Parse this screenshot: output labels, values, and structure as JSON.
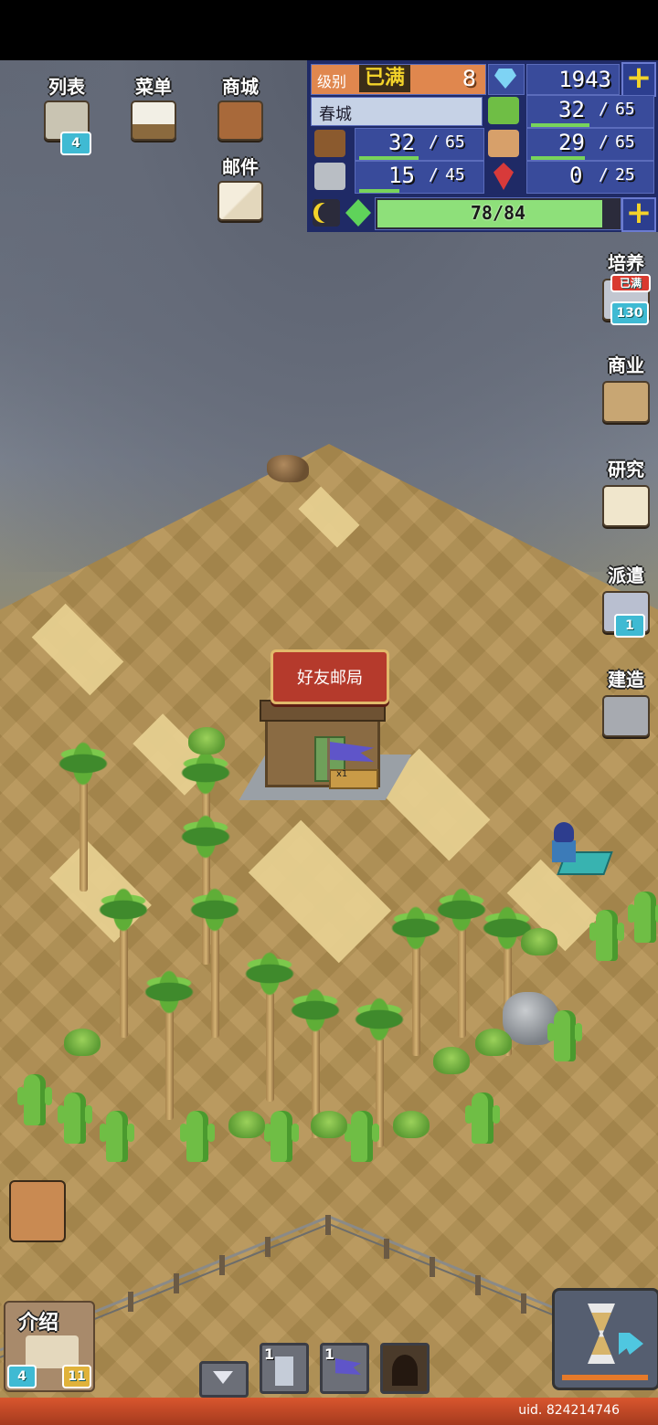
{
  "top_menu": {
    "list": {
      "label": "列表",
      "badge": "4"
    },
    "menu": {
      "label": "菜单"
    },
    "shop": {
      "label": "商城"
    },
    "mail": {
      "label": "邮件"
    }
  },
  "status": {
    "level_label": "级别",
    "level_max_tag": "已满",
    "level_value": "8",
    "gems": "1943",
    "town_name": "春城",
    "grass": {
      "current": "32",
      "max": "65",
      "fraction": 0.49
    },
    "wood": {
      "current": "32",
      "max": "65",
      "fraction": 0.49
    },
    "food": {
      "current": "29",
      "max": "65",
      "fraction": 0.45
    },
    "stone": {
      "current": "15",
      "max": "45",
      "fraction": 0.33
    },
    "ruby": {
      "current": "0",
      "max": "25",
      "fraction": 0.0
    },
    "energy": {
      "text": "78/84",
      "fraction": 0.93
    }
  },
  "side_menu": {
    "train": {
      "label": "培养",
      "tag": "已满",
      "badge": "130"
    },
    "business": {
      "label": "商业"
    },
    "research": {
      "label": "研究"
    },
    "dispatch": {
      "label": "派遣",
      "badge": "1"
    },
    "build": {
      "label": "建造"
    }
  },
  "map": {
    "building_label": "好友邮局",
    "flag_count": "x1"
  },
  "bottom": {
    "intro": {
      "label": "介绍",
      "badge_left": "4",
      "badge_right": "11"
    },
    "slot_tower_count": "1",
    "slot_flag_count": "1",
    "uid": "uid. 824214746"
  },
  "colors": {
    "accent": "#f3d32a",
    "panel": "#1f2a66",
    "bottom_bar": "#c84a26"
  }
}
